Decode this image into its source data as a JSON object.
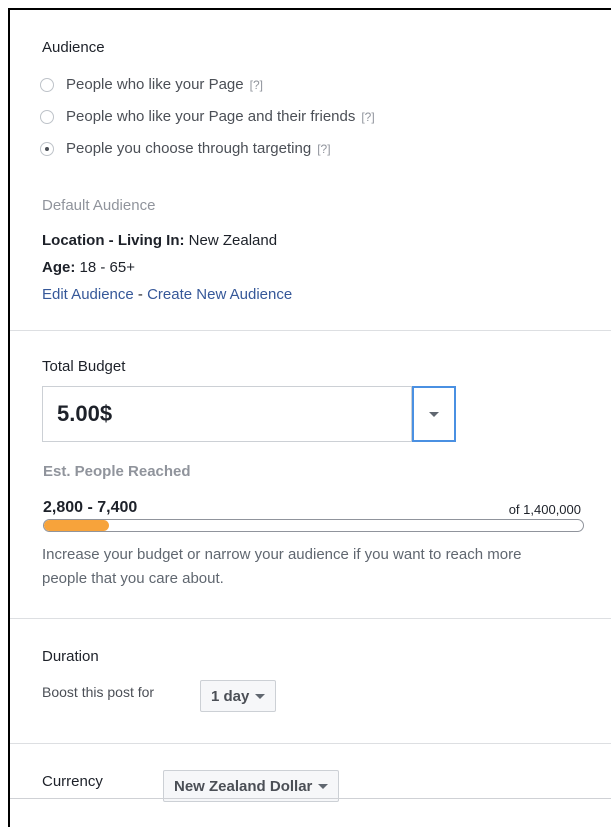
{
  "audience": {
    "title": "Audience",
    "options": [
      {
        "label": "People who like your Page",
        "help": "[?]",
        "checked": false
      },
      {
        "label": "People who like your Page and their friends",
        "help": "[?]",
        "checked": false
      },
      {
        "label": "People you choose through targeting",
        "help": "[?]",
        "checked": true
      }
    ],
    "default_label": "Default Audience",
    "location_label": "Location - Living In:",
    "location_value": "New Zealand",
    "age_label": "Age:",
    "age_value": "18 - 65+",
    "edit_link": "Edit Audience",
    "separator": " - ",
    "create_link": "Create New Audience"
  },
  "budget": {
    "title": "Total Budget",
    "value": "5.00$",
    "est_label": "Est. People Reached",
    "reach_range": "2,800 - 7,400",
    "reach_total": "of 1,400,000",
    "reach_fraction": 0.12,
    "hint": "Increase your budget or narrow your audience if you want to reach more people that you care about."
  },
  "duration": {
    "title": "Duration",
    "label": "Boost this post for",
    "value": "1 day"
  },
  "currency": {
    "title": "Currency",
    "value": "New Zealand Dollar"
  },
  "colors": {
    "accent": "#4a90e2",
    "bar_fill": "#f7a33b",
    "link": "#365899"
  }
}
